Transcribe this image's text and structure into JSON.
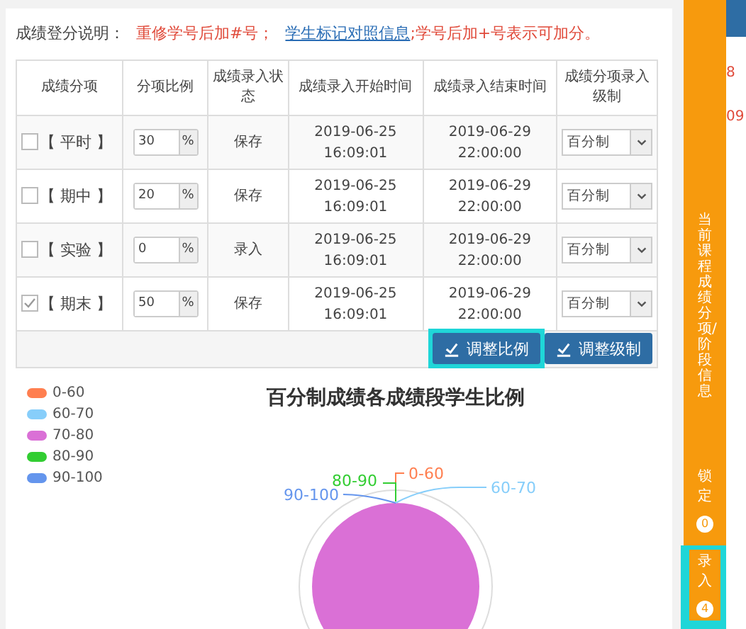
{
  "note": {
    "label": "成绩登分说明：",
    "warning": "重修学号后加#号；",
    "link": "学生标记对照信息",
    "rest": ";学号后加+号表示可加分。"
  },
  "table": {
    "columns": [
      "成绩分项",
      "分项比例",
      "成绩录入状态",
      "成绩录入开始时间",
      "成绩录入结束时间",
      "成绩分项录入级制"
    ],
    "rows": [
      {
        "name": "【 平时 】",
        "checked": false,
        "ratio": "30",
        "unit": "%",
        "status": "保存",
        "start": "2019-06-25 16:09:01",
        "end": "2019-06-29 22:00:00",
        "scale": "百分制"
      },
      {
        "name": "【 期中 】",
        "checked": false,
        "ratio": "20",
        "unit": "%",
        "status": "保存",
        "start": "2019-06-25 16:09:01",
        "end": "2019-06-29 22:00:00",
        "scale": "百分制"
      },
      {
        "name": "【 实验 】",
        "checked": false,
        "ratio": "0",
        "unit": "%",
        "status": "录入",
        "start": "2019-06-25 16:09:01",
        "end": "2019-06-29 22:00:00",
        "scale": "百分制"
      },
      {
        "name": "【 期末 】",
        "checked": true,
        "ratio": "50",
        "unit": "%",
        "status": "保存",
        "start": "2019-06-25 16:09:01",
        "end": "2019-06-29 22:00:00",
        "scale": "百分制"
      }
    ]
  },
  "actions": [
    {
      "label": "调整比例",
      "highlighted": true
    },
    {
      "label": "调整级制",
      "highlighted": false
    }
  ],
  "chart": {
    "title": "百分制成绩各成绩段学生比例",
    "legend": [
      {
        "label": "0-60",
        "color": "#ff7f50"
      },
      {
        "label": "60-70",
        "color": "#87cefa"
      },
      {
        "label": "70-80",
        "color": "#da70d6"
      },
      {
        "label": "80-90",
        "color": "#32cd32"
      },
      {
        "label": "90-100",
        "color": "#6495ed"
      }
    ],
    "slice_labels": [
      {
        "label": "0-60",
        "color": "#ff7f50",
        "kind": "top-right"
      },
      {
        "label": "60-70",
        "color": "#87cefa",
        "kind": "right"
      },
      {
        "label": "80-90",
        "color": "#32cd32",
        "kind": "top-left"
      },
      {
        "label": "90-100",
        "color": "#6495ed",
        "kind": "left"
      }
    ]
  },
  "side_panel": {
    "title": "当前课程成绩分项/阶段信息",
    "items": [
      {
        "label": "锁定",
        "count": "0",
        "highlighted": false
      },
      {
        "label": "录入",
        "count": "4",
        "highlighted": true
      }
    ]
  },
  "background_fragments": [
    "8",
    "09"
  ]
}
